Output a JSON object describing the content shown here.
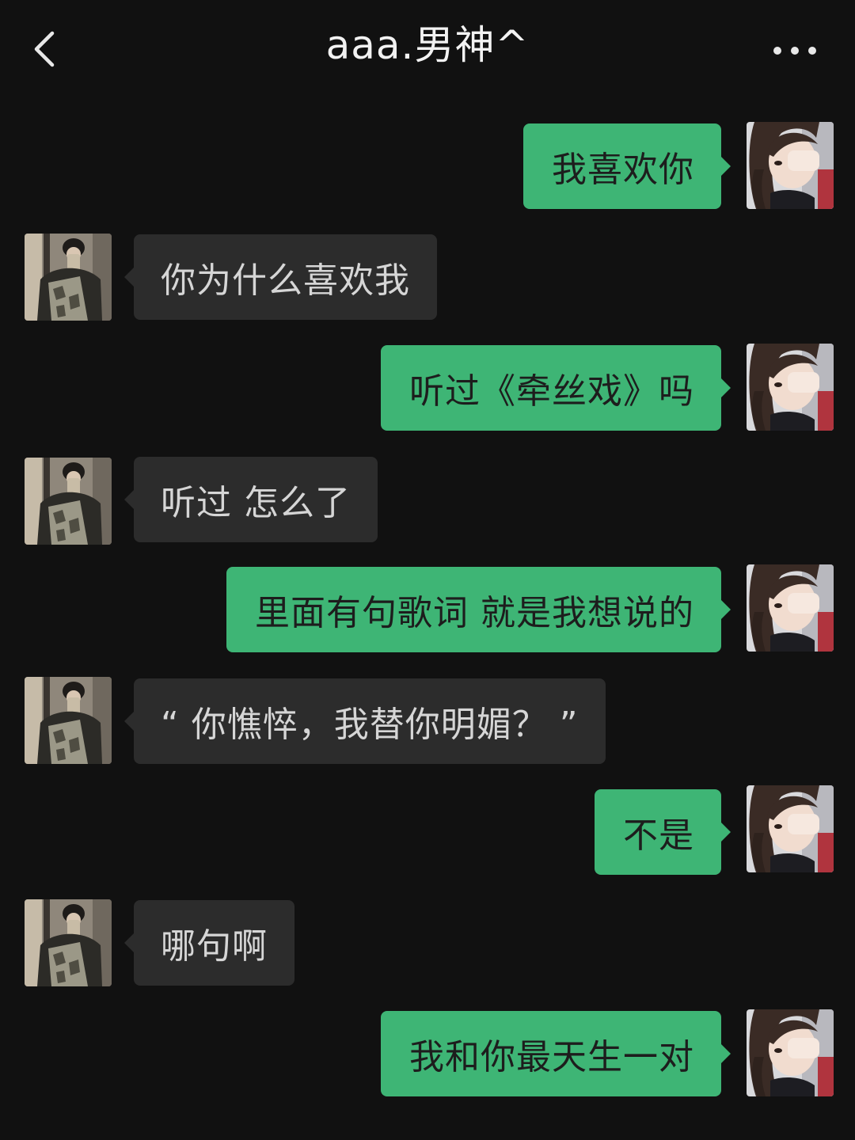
{
  "header": {
    "title": "aaa.男神^",
    "back_icon": "chevron-left-icon",
    "more_icon": "ellipsis-icon"
  },
  "colors": {
    "background": "#111111",
    "outgoing_bubble": "#3eb575",
    "incoming_bubble": "#2c2c2c"
  },
  "messages": [
    {
      "from": "me",
      "text": "我喜欢你"
    },
    {
      "from": "them",
      "text": "你为什么喜欢我"
    },
    {
      "from": "me",
      "text": "听过《牵丝戏》吗"
    },
    {
      "from": "them",
      "text": "听过 怎么了"
    },
    {
      "from": "me",
      "text": "里面有句歌词 就是我想说的"
    },
    {
      "from": "them",
      "text": "“ 你憔悴，我替你明媚？ ”"
    },
    {
      "from": "me",
      "text": "不是"
    },
    {
      "from": "them",
      "text": "哪句啊"
    },
    {
      "from": "me",
      "text": "我和你最天生一对"
    }
  ]
}
